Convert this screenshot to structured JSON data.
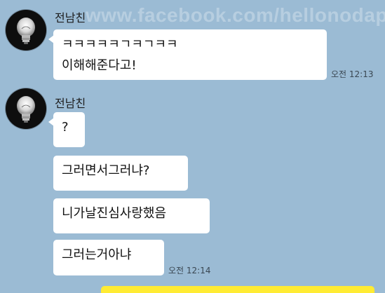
{
  "watermark": "www.facebook.com/hellonodap",
  "messages": [
    {
      "sender": "전남친",
      "avatar_icon": "lightbulb-icon",
      "bubbles": [
        {
          "lines": [
            "ㅋㅋㅋㅋㅋㄱㅋㄱㅋㅋ",
            "이해해준다고!"
          ]
        }
      ],
      "time": "오전 12:13"
    },
    {
      "sender": "전남친",
      "avatar_icon": "lightbulb-icon",
      "bubbles": [
        {
          "lines": [
            "?"
          ]
        },
        {
          "lines": [
            "그러면서그러냐?"
          ]
        },
        {
          "lines": [
            "니가날진심사랑했음"
          ]
        },
        {
          "lines": [
            "그러는거아냐"
          ]
        }
      ],
      "time": "오전 12:14"
    }
  ],
  "colors": {
    "chat_background": "#9bbbd4",
    "bubble_received": "#ffffff",
    "bubble_sent": "#ffeb33"
  }
}
